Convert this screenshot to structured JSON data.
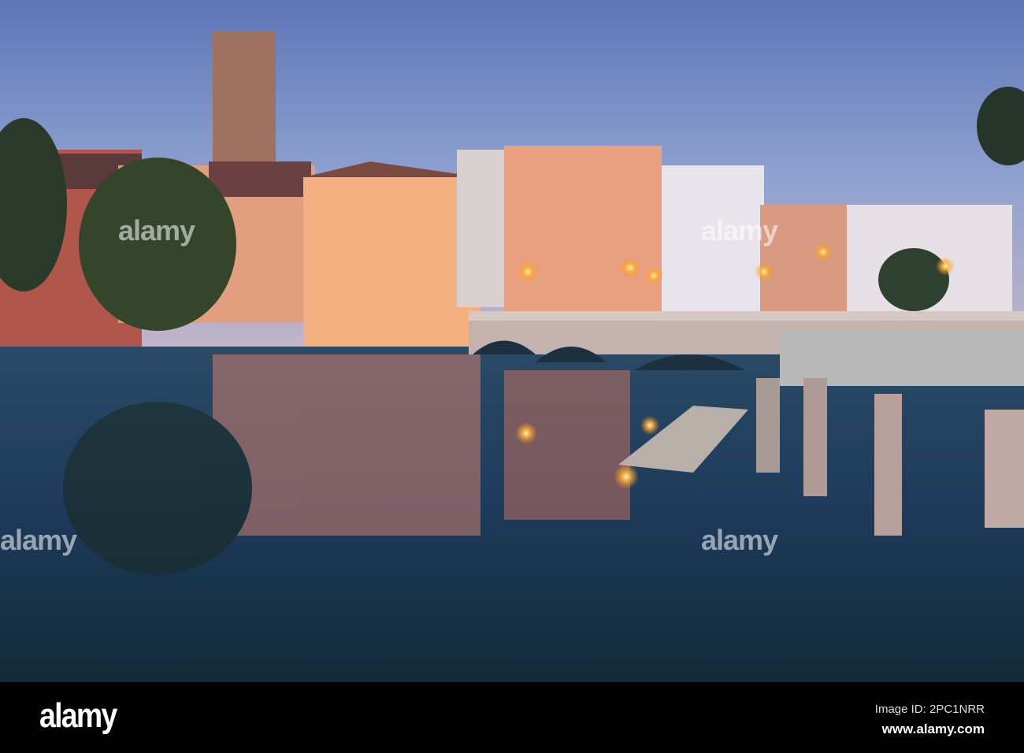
{
  "watermark": {
    "text": "alamy"
  },
  "footer": {
    "logo": "alamy",
    "image_id": "Image ID: 2PC1NRR",
    "website": "www.alamy.com"
  }
}
